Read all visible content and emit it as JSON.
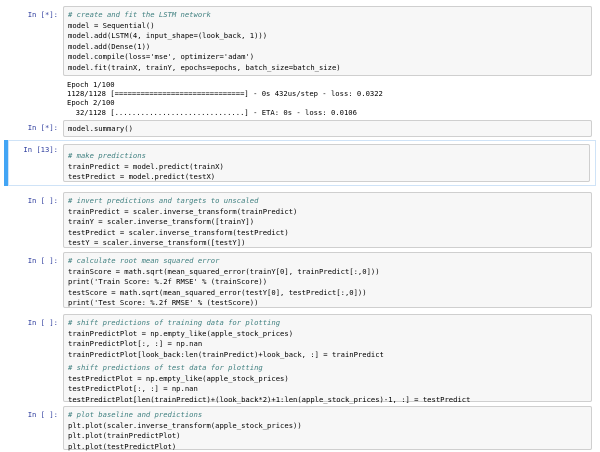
{
  "cells": [
    {
      "prompt": "In [*]:",
      "lines": [
        "# create and fit the LSTM network",
        "model = Sequential()",
        "model.add(LSTM(4, input_shape=(look_back, 1)))",
        "model.add(Dense(1))",
        "model.compile(loss='mse', optimizer='adam')",
        "model.fit(trainX, trainY, epochs=epochs, batch_size=batch_size)"
      ],
      "output": [
        "Epoch 1/100",
        "1128/1128 [==============================] - 0s 432us/step - loss: 0.0322",
        "Epoch 2/100",
        "  32/1128 [..............................] - ETA: 0s - loss: 0.0106"
      ]
    },
    {
      "prompt": "In [*]:",
      "lines": [
        "model.summary()"
      ]
    },
    {
      "prompt": "In [13]:",
      "lines": [
        "",
        "# make predictions",
        "trainPredict = model.predict(trainX)",
        "testPredict = model.predict(testX)"
      ]
    },
    {
      "prompt": "In [ ]:",
      "lines": [
        "# invert predictions and targets to unscaled",
        "trainPredict = scaler.inverse_transform(trainPredict)",
        "trainY = scaler.inverse_transform([trainY])",
        "testPredict = scaler.inverse_transform(testPredict)",
        "testY = scaler.inverse_transform([testY])"
      ]
    },
    {
      "prompt": "In [ ]:",
      "lines": [
        "# calculate root mean squared error",
        "trainScore = math.sqrt(mean_squared_error(trainY[0], trainPredict[:,0]))",
        "print('Train Score: %.2f RMSE' % (trainScore))",
        "testScore = math.sqrt(mean_squared_error(testY[0], testPredict[:,0]))",
        "print('Test Score: %.2f RMSE' % (testScore))"
      ]
    },
    {
      "prompt": "In [ ]:",
      "lines": [
        "# shift predictions of training data for plotting",
        "trainPredictPlot = np.empty_like(apple_stock_prices)",
        "trainPredictPlot[:, :] = np.nan",
        "trainPredictPlot[look_back:len(trainPredict)+look_back, :] = trainPredict",
        "",
        "# shift predictions of test data for plotting",
        "testPredictPlot = np.empty_like(apple_stock_prices)",
        "testPredictPlot[:, :] = np.nan",
        "testPredictPlot[len(trainPredict)+(look_back*2)+1:len(apple_stock_prices)-1, :] = testPredict"
      ]
    },
    {
      "prompt": "In [ ]:",
      "lines": [
        "# plot baseline and predictions",
        "plt.plot(scaler.inverse_transform(apple_stock_prices))",
        "plt.plot(trainPredictPlot)",
        "plt.plot(testPredictPlot)"
      ]
    }
  ]
}
